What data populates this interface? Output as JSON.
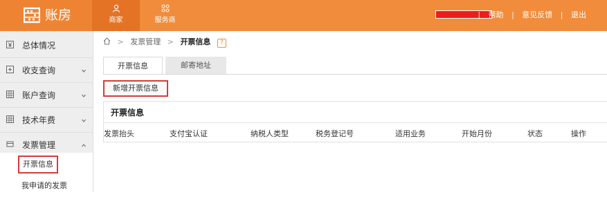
{
  "brand": {
    "name": "账房"
  },
  "nav": [
    {
      "label": "商家",
      "icon": "person-icon",
      "active": true
    },
    {
      "label": "服务商",
      "icon": "grid-icon",
      "active": false
    }
  ],
  "top_links": {
    "help": "帮助",
    "feedback": "意见反馈",
    "logout": "退出",
    "separator": "|"
  },
  "colors": {
    "brand_orange": "#f08c3c",
    "highlight_red": "#d73a3a"
  },
  "sidebar": {
    "items": [
      {
        "label": "总体情况",
        "icon": "yen-icon"
      },
      {
        "label": "收支查询",
        "icon": "document-icon"
      },
      {
        "label": "账户查询",
        "icon": "table-icon"
      },
      {
        "label": "技术年费",
        "icon": "table-icon"
      },
      {
        "label": "发票管理",
        "icon": "invoice-icon"
      }
    ],
    "sub_items": [
      {
        "label": "开票信息",
        "selected": true
      },
      {
        "label": "我申请的发票",
        "selected": false
      }
    ]
  },
  "breadcrumb": {
    "parent": "发票管理",
    "current": "开票信息",
    "help_mark": "?",
    "arrow": ">"
  },
  "tabs": [
    {
      "label": "开票信息",
      "active": true
    },
    {
      "label": "邮寄地址",
      "active": false
    }
  ],
  "actions": {
    "add_invoice_info": "新增开票信息"
  },
  "panel": {
    "title": "开票信息",
    "columns": [
      "发票抬头",
      "支付宝认证",
      "纳税人类型",
      "税务登记号",
      "适用业务",
      "开始月份",
      "状态",
      "操作"
    ]
  }
}
